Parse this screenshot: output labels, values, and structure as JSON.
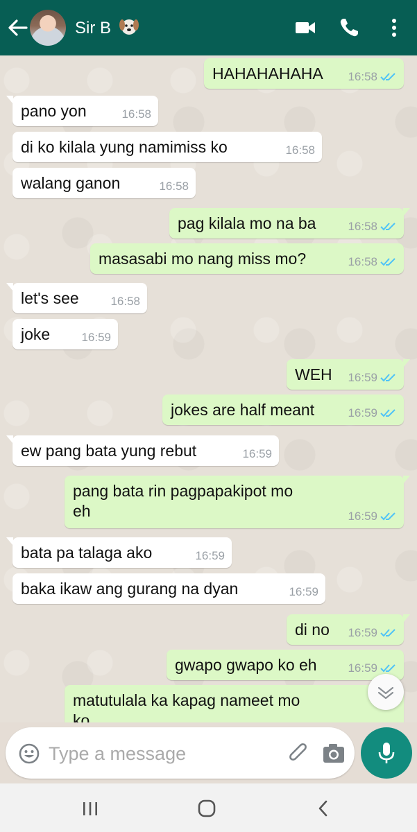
{
  "header": {
    "contact_name": "Sir B",
    "icons": [
      "back-arrow-icon",
      "avatar",
      "dog-emoji-icon",
      "video-call-icon",
      "phone-icon",
      "more-options-icon"
    ]
  },
  "messages": [
    {
      "dir": "out",
      "text": "HAHAHAHAHA",
      "time": "16:58",
      "ticks": "read"
    },
    {
      "dir": "in",
      "text": "pano yon",
      "time": "16:58"
    },
    {
      "dir": "in",
      "text": "di ko kilala yung namimiss ko",
      "time": "16:58"
    },
    {
      "dir": "in",
      "text": "walang ganon",
      "time": "16:58"
    },
    {
      "dir": "out",
      "text": "pag kilala mo na ba",
      "time": "16:58",
      "ticks": "read"
    },
    {
      "dir": "out",
      "text": "masasabi mo nang miss mo?",
      "time": "16:58",
      "ticks": "read"
    },
    {
      "dir": "in",
      "text": "let's see",
      "time": "16:58"
    },
    {
      "dir": "in",
      "text": "joke",
      "time": "16:59"
    },
    {
      "dir": "out",
      "text": "WEH",
      "time": "16:59",
      "ticks": "read"
    },
    {
      "dir": "out",
      "text": "jokes are half meant",
      "time": "16:59",
      "ticks": "read"
    },
    {
      "dir": "in",
      "text": "ew pang bata yung rebut",
      "time": "16:59"
    },
    {
      "dir": "out",
      "text": "pang bata rin pagpapakipot mo",
      "text2": "eh",
      "time": "16:59",
      "ticks": "read"
    },
    {
      "dir": "in",
      "text": "bata pa talaga ako",
      "time": "16:59"
    },
    {
      "dir": "in",
      "text": "baka ikaw ang gurang na dyan",
      "time": "16:59"
    },
    {
      "dir": "out",
      "text": "di no",
      "time": "16:59",
      "ticks": "read"
    },
    {
      "dir": "out",
      "text": "gwapo gwapo ko eh",
      "time": "16:59",
      "ticks": "read"
    },
    {
      "dir": "out",
      "text": "matutulala ka kapag nameet mo",
      "text2": "ko",
      "time": "",
      "ticks": "",
      "partial": true
    }
  ],
  "composer": {
    "placeholder": "Type a message",
    "icons": [
      "emoji-icon",
      "attach-icon",
      "camera-icon",
      "mic-icon"
    ]
  },
  "colors": {
    "header_bg": "#075e54",
    "outgoing_bubble": "#dcf8c6",
    "incoming_bubble": "#ffffff",
    "read_ticks": "#4fc3f7",
    "mic_button": "#128c7e"
  },
  "navbar": {
    "icons": [
      "recents-icon",
      "home-icon",
      "back-icon"
    ]
  }
}
